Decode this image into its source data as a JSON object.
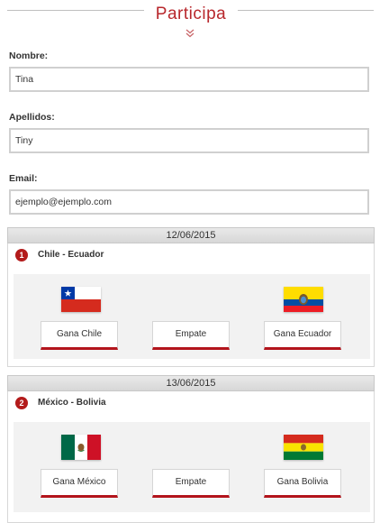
{
  "header": {
    "title": "Participa"
  },
  "form": {
    "nombre": {
      "label": "Nombre:",
      "value": "Tina"
    },
    "apellidos": {
      "label": "Apellidos:",
      "value": "Tiny"
    },
    "email": {
      "label": "Email:",
      "value": "ejemplo@ejemplo.com"
    }
  },
  "matches": [
    {
      "date": "12/06/2015",
      "number": "1",
      "teams": "Chile - Ecuador",
      "home_flag": "chile-flag",
      "away_flag": "ecuador-flag",
      "buttons": [
        "Gana Chile",
        "Empate",
        "Gana Ecuador"
      ]
    },
    {
      "date": "13/06/2015",
      "number": "2",
      "teams": "México - Bolivia",
      "home_flag": "mexico-flag",
      "away_flag": "bolivia-flag",
      "buttons": [
        "Gana México",
        "Empate",
        "Gana Bolivia"
      ]
    }
  ],
  "colors": {
    "accent": "#b8272c",
    "button_border": "#b3141c",
    "panel_bg": "#f2f2f2"
  }
}
